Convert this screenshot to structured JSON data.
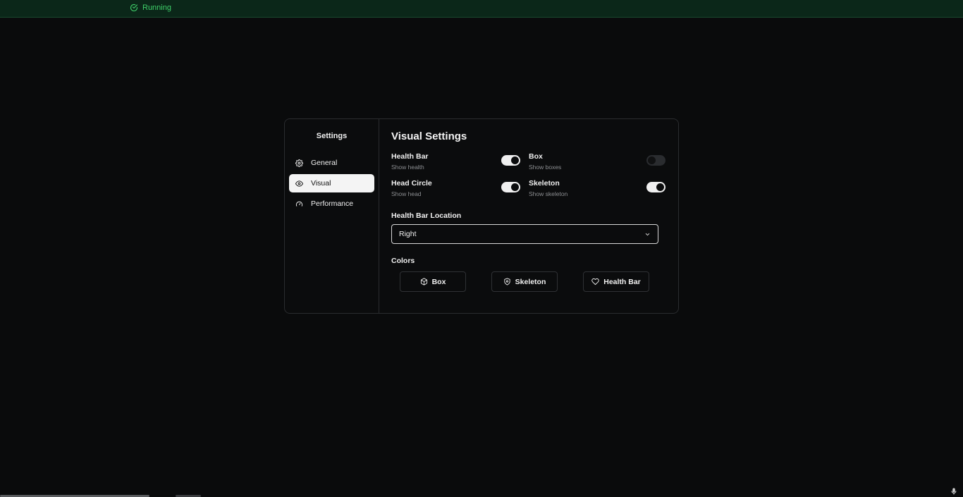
{
  "status": {
    "text": "Running",
    "color": "#3fd06a",
    "icon": "check-circle-icon"
  },
  "sidebar": {
    "title": "Settings",
    "items": [
      {
        "label": "General",
        "icon": "gear-icon",
        "active": false
      },
      {
        "label": "Visual",
        "icon": "eye-icon",
        "active": true
      },
      {
        "label": "Performance",
        "icon": "gauge-icon",
        "active": false
      }
    ]
  },
  "content": {
    "title": "Visual Settings",
    "settings": [
      {
        "label": "Health Bar",
        "desc": "Show health",
        "on": true
      },
      {
        "label": "Box",
        "desc": "Show boxes",
        "on": false
      },
      {
        "label": "Head Circle",
        "desc": "Show head",
        "on": true
      },
      {
        "label": "Skeleton",
        "desc": "Show skeleton",
        "on": true
      }
    ],
    "location": {
      "label": "Health Bar Location",
      "value": "Right"
    },
    "colors": {
      "label": "Colors",
      "buttons": [
        {
          "label": "Box",
          "icon": "cube-icon"
        },
        {
          "label": "Skeleton",
          "icon": "shield-icon"
        },
        {
          "label": "Health Bar",
          "icon": "heart-icon"
        }
      ]
    }
  }
}
